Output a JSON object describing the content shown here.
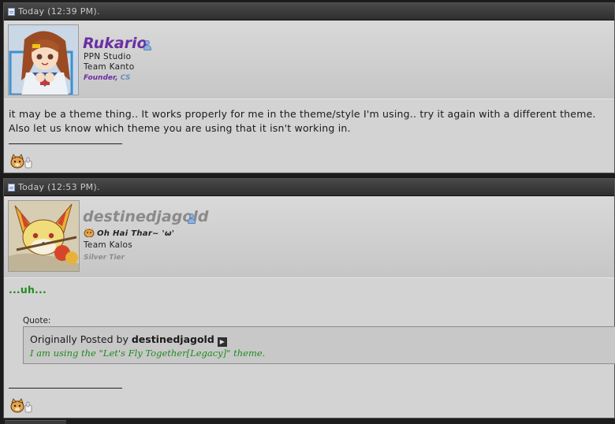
{
  "posts": [
    {
      "timestamp": "Today (12:39 PM).",
      "username": "Rukario",
      "user_lines": [
        "PPN Studio",
        "Team Kanto"
      ],
      "rank": {
        "primary": "Founder",
        "separator": ", ",
        "secondary": "CS"
      },
      "message_lines": [
        "it may be a theme thing.. It works properly for me in the theme/style I'm using.. try it again with a different theme.",
        "Also let us know which theme you are using that it isn't working in."
      ],
      "avatar_icon": "anime-girl-avatar",
      "reaction_icon": "pokemon-reaction-icon"
    },
    {
      "timestamp": "Today (12:53 PM).",
      "username": "destinedjagold",
      "user_title": "Oh Hai Thar~ 'ω'",
      "user_lines": [
        "Team Kalos"
      ],
      "rank": {
        "primary": "Silver Tier"
      },
      "message": "...uh...",
      "quote": {
        "label": "Quote:",
        "posted_by_prefix": "Originally Posted by",
        "posted_by": "destinedjagold",
        "text": "I am using the \"Let's Fly Together[Legacy]\" theme."
      },
      "avatar_icon": "fennekin-avatar",
      "reaction_icon": "pokemon-reaction-icon"
    }
  ],
  "colors": {
    "username_founder": "#6a2fa2",
    "username_silver": "#8a8a8a",
    "message_green": "#1f8a1f",
    "header_bg": "#3a3a3a",
    "post_bg": "#d3d3d3"
  }
}
